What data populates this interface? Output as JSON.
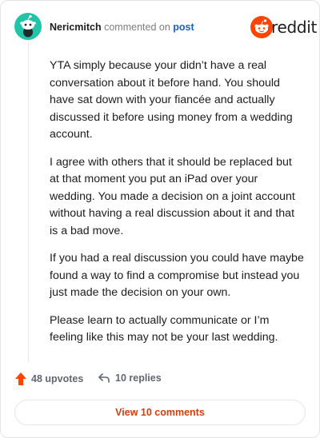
{
  "comment": {
    "author": "Nericmitch",
    "action_text": "commented on",
    "post_link": "post",
    "paragraphs": [
      "YTA simply because your didn’t have a real conversation about it before hand. You should have sat down with your fiancée and actually discussed it before using money from a wedding account.",
      "I agree with others that it should be replaced but at that moment you put an iPad over your wedding. You made a decision on a joint account without having a real discussion about it and that is a bad move.",
      "If you had a real discussion you could have maybe found a way to find a compromise but instead you just made the decision on your own.",
      "Please learn to actually communicate or I’m feeling like this may not be your last wedding."
    ]
  },
  "brand": {
    "name": "reddit",
    "logo_icon": "reddit-alien-icon",
    "accent": "#ff4500"
  },
  "avatar": {
    "icon": "snoo-avatar-icon",
    "color": "#22c4a7"
  },
  "stats": {
    "upvotes": "48 upvotes",
    "replies": "10 replies",
    "upvote_icon": "upvote-arrow-icon",
    "reply_icon": "reply-arrow-icon"
  },
  "footer": {
    "view_comments_label": "View 10 comments",
    "label_color": "#d63e0e"
  }
}
